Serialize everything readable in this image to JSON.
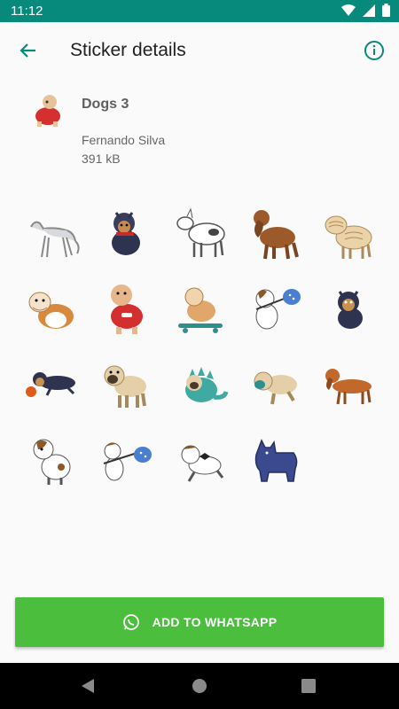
{
  "status_bar": {
    "time": "11:12"
  },
  "app_bar": {
    "title": "Sticker details"
  },
  "pack": {
    "name": "Dogs 3",
    "publisher": "Fernando Silva",
    "size": "391 kB"
  },
  "stickers": [
    {
      "name": "greyhound"
    },
    {
      "name": "yorkshire-terrier-red-collar"
    },
    {
      "name": "bull-terrier"
    },
    {
      "name": "cocker-spaniel"
    },
    {
      "name": "shar-pei"
    },
    {
      "name": "bulldog-sitting"
    },
    {
      "name": "bulldog-red-sweater"
    },
    {
      "name": "bulldog-skateboard"
    },
    {
      "name": "jack-russell-bindle"
    },
    {
      "name": "yorkshire-terrier-sitting"
    },
    {
      "name": "yorkshire-terrier-ball"
    },
    {
      "name": "pug-standing"
    },
    {
      "name": "pug-dinosaur-costume"
    },
    {
      "name": "pug-with-toy"
    },
    {
      "name": "dachshund"
    },
    {
      "name": "jack-russell-sitting"
    },
    {
      "name": "jack-russell-bindle-2"
    },
    {
      "name": "jack-russell-bow-tie"
    },
    {
      "name": "scottish-terrier"
    }
  ],
  "add_button": {
    "label": "ADD TO WHATSAPP"
  },
  "colors": {
    "status_bar": "#078a7b",
    "accent": "#078a7b",
    "add_button": "#4bbf3d"
  }
}
